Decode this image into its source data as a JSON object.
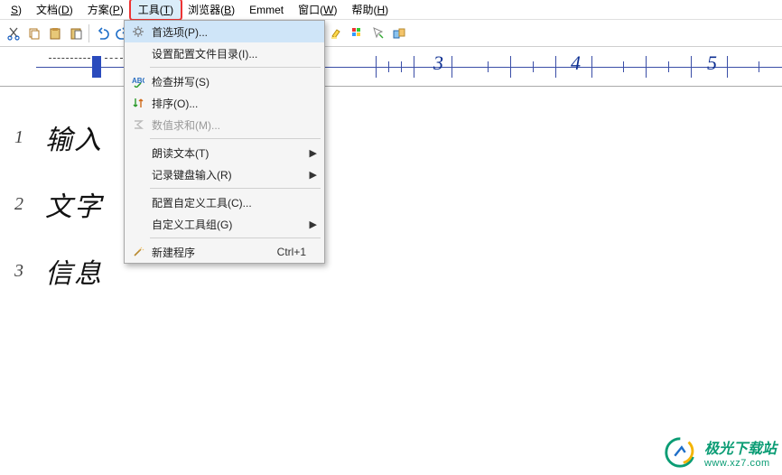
{
  "menubar": {
    "items": [
      {
        "label": "S)",
        "u": "S"
      },
      {
        "label": "文档",
        "u": "D"
      },
      {
        "label": "方案",
        "u": "P"
      },
      {
        "label": "工具",
        "u": "T",
        "highlight": true
      },
      {
        "label": "浏览器",
        "u": "B"
      },
      {
        "label": "Emmet",
        "u": ""
      },
      {
        "label": "窗口",
        "u": "W"
      },
      {
        "label": "帮助",
        "u": "H"
      }
    ]
  },
  "toolbar": {
    "icons": [
      "cut",
      "copy",
      "paste",
      "clipboard",
      "undo",
      "redo",
      "search",
      "search-dir",
      "nav-back",
      "nav-fwd",
      "bookmark-prev",
      "bookmark-next",
      "terminal",
      "app-window",
      "highlight",
      "table",
      "select-tool",
      "component"
    ]
  },
  "ruler": {
    "marks": [
      3,
      4,
      5
    ]
  },
  "content": {
    "lines": [
      {
        "no": "1",
        "text": "输入"
      },
      {
        "no": "2",
        "text": "文字"
      },
      {
        "no": "3",
        "text": "信息"
      }
    ]
  },
  "dropdown": {
    "items": [
      {
        "icon": "gear",
        "label": "首选项(P)...",
        "highlight": true
      },
      {
        "icon": "",
        "label": "设置配置文件目录(I)..."
      },
      {
        "sep": true
      },
      {
        "icon": "spellcheck",
        "label": "检查拼写(S)"
      },
      {
        "icon": "sort",
        "label": "排序(O)..."
      },
      {
        "icon": "sigma",
        "label": "数值求和(M)...",
        "disabled": true
      },
      {
        "sep": true
      },
      {
        "icon": "",
        "label": "朗读文本(T)",
        "submenu": true
      },
      {
        "icon": "",
        "label": "记录键盘输入(R)",
        "submenu": true
      },
      {
        "sep": true
      },
      {
        "icon": "",
        "label": "配置自定义工具(C)..."
      },
      {
        "icon": "",
        "label": "自定义工具组(G)",
        "submenu": true
      },
      {
        "sep": true
      },
      {
        "icon": "wand",
        "label": "新建程序",
        "accel": "Ctrl+1"
      }
    ]
  },
  "watermark": {
    "title": "极光下载站",
    "url": "www.xz7.com"
  }
}
